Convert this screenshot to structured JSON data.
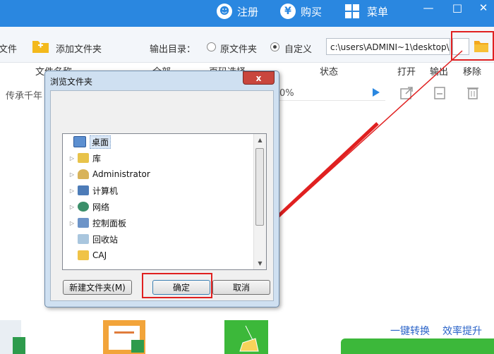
{
  "header": {
    "register_label": "注册",
    "register_icon": "user-icon",
    "buy_label": "购买",
    "buy_icon": "yen-icon",
    "menu_label": "菜单",
    "menu_icon": "grid-icon",
    "minimize": "—",
    "maximize": "□",
    "close": "✕",
    "bg_color": "#2a87e0"
  },
  "toolbar": {
    "add_file_label": "文件",
    "add_folder_label": "添加文件夹",
    "output_dir_label": "输出目录：",
    "radio_original": "原文件夹",
    "radio_custom": "自定义",
    "selected_option": "自定义",
    "output_path": "c:\\users\\ADMINI~1\\desktop\\"
  },
  "table": {
    "columns": [
      "文件名称",
      "全部",
      "页码选择",
      "状态",
      "打开",
      "输出",
      "移除"
    ],
    "rows": [
      {
        "name": "传承千年",
        "progress": "0%"
      }
    ]
  },
  "dialog": {
    "title": "浏览文件夹",
    "close_label": "x",
    "tree": [
      {
        "label": "桌面",
        "icon": "desktop-icon",
        "expandable": false,
        "depth": 0,
        "selected": true
      },
      {
        "label": "库",
        "icon": "library-icon",
        "expandable": true,
        "depth": 1,
        "selected": false
      },
      {
        "label": "Administrator",
        "icon": "user-folder-icon",
        "expandable": true,
        "depth": 1,
        "selected": false
      },
      {
        "label": "计算机",
        "icon": "computer-icon",
        "expandable": true,
        "depth": 1,
        "selected": false
      },
      {
        "label": "网络",
        "icon": "network-icon",
        "expandable": true,
        "depth": 1,
        "selected": false
      },
      {
        "label": "控制面板",
        "icon": "control-panel-icon",
        "expandable": true,
        "depth": 1,
        "selected": false
      },
      {
        "label": "回收站",
        "icon": "recycle-bin-icon",
        "expandable": false,
        "depth": 1,
        "selected": false
      },
      {
        "label": "CAJ",
        "icon": "folder-icon",
        "expandable": false,
        "depth": 1,
        "selected": false
      }
    ],
    "new_folder_button": "新建文件夹(M)",
    "ok_button": "确定",
    "cancel_button": "取消"
  },
  "footer": {
    "slogan_left": "一键转换",
    "slogan_right": "效率提升"
  },
  "colors": {
    "accent": "#2a87e0",
    "highlight_box": "#e02020",
    "start_button": "#3cb83a"
  }
}
